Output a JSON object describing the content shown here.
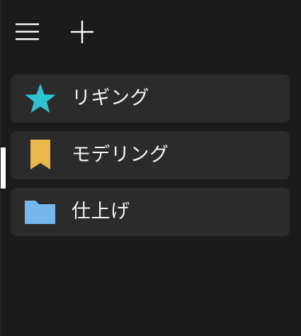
{
  "toolbar": {
    "menu_icon": "hamburger-icon",
    "add_icon": "plus-icon"
  },
  "nav": {
    "items": [
      {
        "label": "リギング",
        "icon": "star-icon",
        "color": "#2ec4cf",
        "selected": false
      },
      {
        "label": "モデリング",
        "icon": "bookmark-icon",
        "color": "#e9b64a",
        "selected": true
      },
      {
        "label": "仕上げ",
        "icon": "folder-icon",
        "color": "#75b6ec",
        "selected": false
      }
    ]
  },
  "colors": {
    "background": "#1b1b1b",
    "item_background": "#2b2b2b",
    "selection_indicator": "#ffffff"
  }
}
